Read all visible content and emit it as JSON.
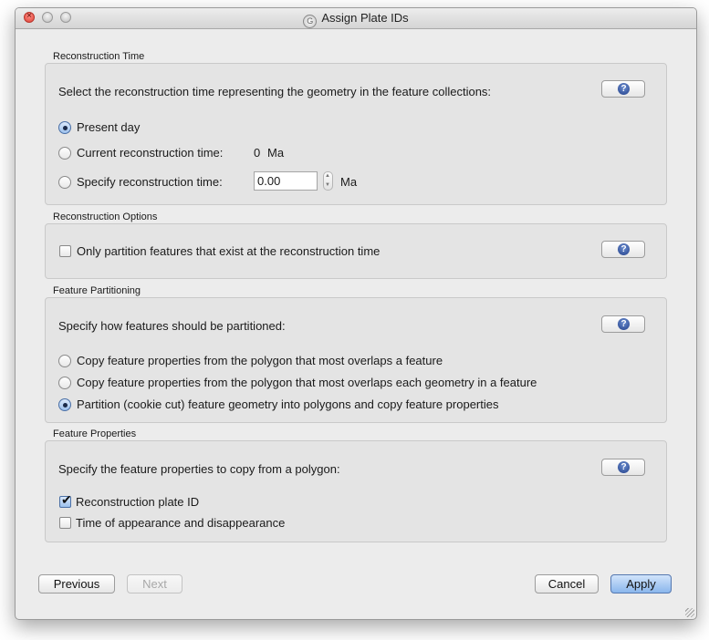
{
  "window": {
    "title": "Assign Plate IDs"
  },
  "reconstruction_time": {
    "label": "Reconstruction Time",
    "prompt": "Select the reconstruction time representing the geometry in the feature collections:",
    "options": [
      {
        "label": "Present day",
        "selected": true
      },
      {
        "label": "Current reconstruction time:",
        "selected": false
      },
      {
        "label": "Specify reconstruction time:",
        "selected": false
      }
    ],
    "current_value": "0",
    "current_unit": "Ma",
    "specify_value": "0.00",
    "specify_unit": "Ma"
  },
  "reconstruction_options": {
    "label": "Reconstruction Options",
    "checkbox_label": "Only partition features that exist at the reconstruction time",
    "checked": false
  },
  "feature_partitioning": {
    "label": "Feature Partitioning",
    "prompt": "Specify how features should be partitioned:",
    "options": [
      {
        "label": "Copy feature properties from the polygon that most overlaps a feature",
        "selected": false
      },
      {
        "label": "Copy feature properties from the polygon that most overlaps each geometry in a feature",
        "selected": false
      },
      {
        "label": "Partition (cookie cut) feature geometry into polygons and copy feature properties",
        "selected": true
      }
    ]
  },
  "feature_properties": {
    "label": "Feature Properties",
    "prompt": "Specify the feature properties to copy from a polygon:",
    "checkboxes": [
      {
        "label": "Reconstruction plate ID",
        "checked": true
      },
      {
        "label": "Time of appearance and disappearance",
        "checked": false
      }
    ]
  },
  "footer": {
    "previous": "Previous",
    "next": "Next",
    "cancel": "Cancel",
    "apply": "Apply"
  },
  "help_glyph": "?",
  "check_glyph": "✔",
  "colors": {
    "accent": "#8ab6ec",
    "help_icon": "#223f8a",
    "close_light": "#e0443a"
  }
}
